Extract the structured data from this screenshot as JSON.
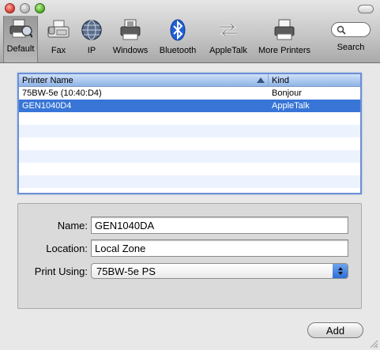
{
  "toolbar": {
    "items": [
      {
        "label": "Default",
        "icon": "default-printer-icon",
        "selected": true
      },
      {
        "label": "Fax",
        "icon": "fax-icon"
      },
      {
        "label": "IP",
        "icon": "globe-icon"
      },
      {
        "label": "Windows",
        "icon": "windows-printer-icon"
      },
      {
        "label": "Bluetooth",
        "icon": "bluetooth-icon"
      },
      {
        "label": "AppleTalk",
        "icon": "appletalk-icon"
      },
      {
        "label": "More Printers",
        "icon": "more-printers-icon"
      },
      {
        "label": "Search",
        "icon": "search-icon"
      }
    ]
  },
  "table": {
    "columns": [
      "Printer Name",
      "Kind"
    ],
    "rows": [
      {
        "name": "75BW-5e (10:40:D4)",
        "kind": "Bonjour",
        "selected": false
      },
      {
        "name": "GEN1040D4",
        "kind": "AppleTalk",
        "selected": true
      }
    ]
  },
  "details": {
    "name_label": "Name:",
    "name_value": "GEN1040DA",
    "location_label": "Location:",
    "location_value": "Local Zone",
    "print_using_label": "Print Using:",
    "print_using_value": "75BW-5e PS"
  },
  "buttons": {
    "add_label": "Add"
  },
  "colors": {
    "selection": "#3875d7",
    "table_border": "#6d8fd2"
  }
}
